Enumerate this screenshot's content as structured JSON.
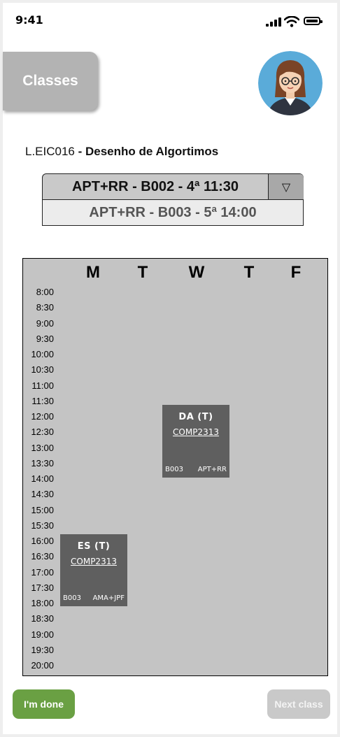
{
  "status_bar": {
    "time": "9:41"
  },
  "header": {
    "classes_label": "Classes"
  },
  "course": {
    "code": "L.EIC016",
    "separator": " - ",
    "name": "Desenho de Algortimos"
  },
  "class_select": {
    "selected": "APT+RR - B002 - 4ª 11:30",
    "arrow": "▽",
    "option": "APT+RR - B003 - 5ª 14:00"
  },
  "timetable": {
    "days": [
      "M",
      "T",
      "W",
      "T",
      "F"
    ],
    "times": [
      "8:00",
      "8:30",
      "9:00",
      "9:30",
      "10:00",
      "10:30",
      "11:00",
      "11:30",
      "12:00",
      "12:30",
      "13:00",
      "13:30",
      "14:00",
      "14:30",
      "15:00",
      "15:30",
      "16:00",
      "16:30",
      "17:00",
      "17:30",
      "18:00",
      "18:30",
      "19:00",
      "19:30",
      "20:00"
    ],
    "classes": [
      {
        "title": "DA (T)",
        "code": "COMP2313",
        "room": "B003",
        "teachers": "APT+RR",
        "day": "W",
        "start": "12:00",
        "end": "14:00"
      },
      {
        "title": "ES (T)",
        "code": "COMP2313",
        "room": "B003",
        "teachers": "AMA+JPF",
        "day": "M",
        "start": "16:00",
        "end": "18:00"
      }
    ]
  },
  "footer": {
    "done_label": "I'm done",
    "next_label": "Next class"
  },
  "colors": {
    "done": "#6aa043",
    "next_disabled": "#c9c9c9",
    "class_block": "#5f5f5f",
    "timetable_bg": "#c4c4c4"
  }
}
